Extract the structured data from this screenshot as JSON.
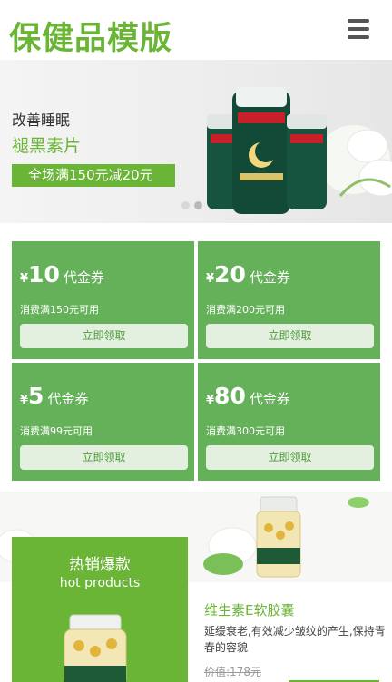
{
  "header": {
    "logo": "保健品模版",
    "menu_icon": "menu-icon"
  },
  "banner": {
    "subtitle": "改善睡眠",
    "title": "褪黑素片",
    "promo": "全场满150元减20元",
    "dots": 2,
    "active_dot": 1
  },
  "coupons": [
    {
      "currency": "¥",
      "amount": "10",
      "label": "代金券",
      "condition": "消费满150元可用",
      "button": "立即领取"
    },
    {
      "currency": "¥",
      "amount": "20",
      "label": "代金券",
      "condition": "消费满200元可用",
      "button": "立即领取"
    },
    {
      "currency": "¥",
      "amount": "5",
      "label": "代金券",
      "condition": "消费满99元可用",
      "button": "立即领取"
    },
    {
      "currency": "¥",
      "amount": "80",
      "label": "代金券",
      "condition": "消费满300元可用",
      "button": "立即领取"
    }
  ],
  "hot": {
    "title": "热销爆款",
    "subtitle": "hot products"
  },
  "product": {
    "name": "维生素E软胶囊",
    "description": "延缓衰老,有效减少皱纹的产生,保持青春的容貌",
    "price": "价值:178元"
  },
  "colors": {
    "brand": "#6ab536",
    "coupon_bg": "#65b15a",
    "button_bg": "#e3f0df"
  }
}
